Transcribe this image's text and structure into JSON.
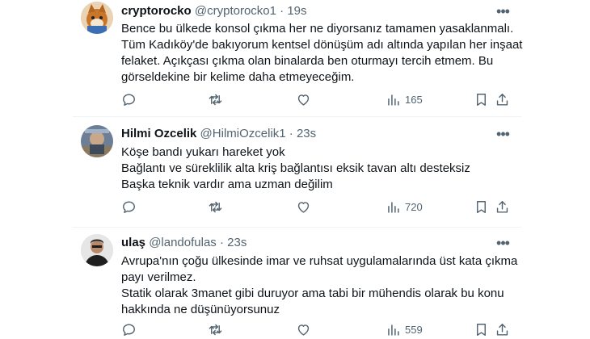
{
  "tweets": [
    {
      "name": "cryptorocko",
      "handle": "@cryptorocko1",
      "sep": "·",
      "time": "19s",
      "lines": [
        "Bence bu ülkede konsol çıkma her ne diyorsanız tamamen yasaklanmalı.",
        "Tüm Kadıköy'de bakıyorum kentsel dönüşüm adı altında yapılan her inşaat",
        "felaket. Açıkçası çıkma olan binalarda ben oturmayı tercih etmem. Bu",
        "görseldekine bir kelime daha etmeyeceğim."
      ],
      "views": "165",
      "avatar_icon": "avatar-fox-icon"
    },
    {
      "name": "Hilmi Ozcelik",
      "handle": "@HilmiOzcelik1",
      "sep": "·",
      "time": "23s",
      "lines": [
        "Köşe bandı yukarı hareket yok",
        "Bağlantı ve süreklilik alta kriş bağlantısı eksik tavan altı desteksiz",
        "Başka teknik vardır ama uzman değilim"
      ],
      "views": "720",
      "avatar_icon": "avatar-photo-icon"
    },
    {
      "name": "ulaş",
      "handle": "@landofulas",
      "sep": "·",
      "time": "23s",
      "lines": [
        "Avrupa'nın çoğu ülkesinde imar ve ruhsat uygulamalarında üst kata çıkma",
        "payı verilmez.",
        "Statik olarak 3manet gibi duruyor ama tabi bir mühendis olarak bu konu",
        "hakkında ne düşünüyorsunuz"
      ],
      "views": "559",
      "avatar_icon": "avatar-person-icon"
    }
  ],
  "icons": {
    "more": "more-dots-icon",
    "reply": "reply-icon",
    "retweet": "retweet-icon",
    "like": "like-icon",
    "views": "views-icon",
    "bookmark": "bookmark-icon",
    "share": "share-icon"
  },
  "colors": {
    "text": "#0f1419",
    "muted": "#536471",
    "divider": "#eff3f4"
  }
}
